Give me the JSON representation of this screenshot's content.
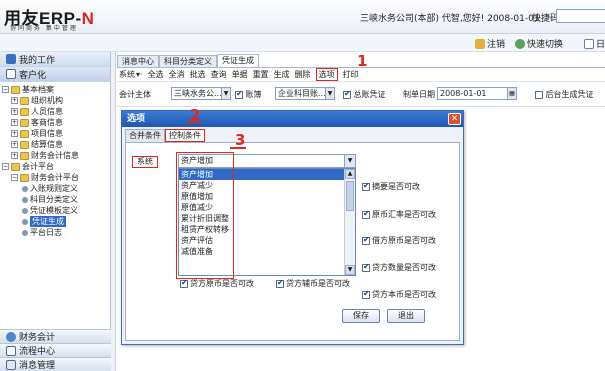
{
  "header": {
    "logo_main": "用友ERP-",
    "logo_suffix": "N",
    "logo_tag": "协同商务 集中管理",
    "company_info": "三峡水务公司(本部) 代智,您好! 2008-01-01",
    "quickcode_label": "快捷码"
  },
  "toprow": {
    "logout": "注销",
    "quickswitch": "快速切换",
    "more": "日"
  },
  "sidebar": {
    "my_work": "我的工作",
    "customize": "客户化",
    "tree": [
      {
        "label": "基本档案",
        "level": 0,
        "pm": "−",
        "type": "folder"
      },
      {
        "label": "组织机构",
        "level": 1,
        "pm": "+",
        "type": "folder"
      },
      {
        "label": "人员信息",
        "level": 1,
        "pm": "+",
        "type": "folder"
      },
      {
        "label": "客商信息",
        "level": 1,
        "pm": "+",
        "type": "folder"
      },
      {
        "label": "项目信息",
        "level": 1,
        "pm": "+",
        "type": "folder"
      },
      {
        "label": "结算信息",
        "level": 1,
        "pm": "+",
        "type": "folder"
      },
      {
        "label": "财务会计信息",
        "level": 1,
        "pm": "+",
        "type": "folder"
      },
      {
        "label": "会计平台",
        "level": 0,
        "pm": "−",
        "type": "folder"
      },
      {
        "label": "财务会计平台",
        "level": 1,
        "pm": "−",
        "type": "folder"
      },
      {
        "label": "入账规则定义",
        "level": 2,
        "type": "leaf"
      },
      {
        "label": "科目分类定义",
        "level": 2,
        "type": "leaf"
      },
      {
        "label": "凭证模板定义",
        "level": 2,
        "type": "leaf"
      },
      {
        "label": "凭证生成",
        "level": 2,
        "type": "leaf",
        "selected": true
      },
      {
        "label": "平台日志",
        "level": 2,
        "type": "leaf"
      }
    ],
    "bottom": [
      "财务会计",
      "流程中心",
      "消息管理"
    ]
  },
  "tabs": [
    "消息中心",
    "科目分类定义",
    "凭证生成"
  ],
  "menubar": [
    "系统",
    "全选",
    "全消",
    "批选",
    "查询",
    "单据",
    "重置",
    "生成",
    "删除",
    "选项",
    "打印"
  ],
  "form": {
    "entity_label": "会计主体",
    "entity_value": "三峡水务公...",
    "book_label": "账簿",
    "book_value": "企业科目账...",
    "summary_label": "总账凭证",
    "date_label": "制单日期",
    "date_value": "2008-01-01",
    "bg_label": "后台生成凭证"
  },
  "dialog": {
    "title": "选项",
    "tabs": [
      "合并条件",
      "控制条件"
    ],
    "system_label": "系统",
    "combo_value": "资产增加",
    "options": [
      "资产增加",
      "资产减少",
      "原值增加",
      "原值减少",
      "累计折旧调整",
      "租赁产权转移",
      "资产评估",
      "减值准备"
    ],
    "right_checks": [
      "摘要是否可改",
      "原币汇率是否可改",
      "借方原币是否可改",
      "贷方数量是否可改",
      "贷方本币是否可改"
    ],
    "bottom_checks": [
      "贷方原币是否可改",
      "贷方辅币是否可改"
    ],
    "save": "保存",
    "exit": "退出"
  },
  "annotations": [
    "1",
    "2",
    "3"
  ]
}
